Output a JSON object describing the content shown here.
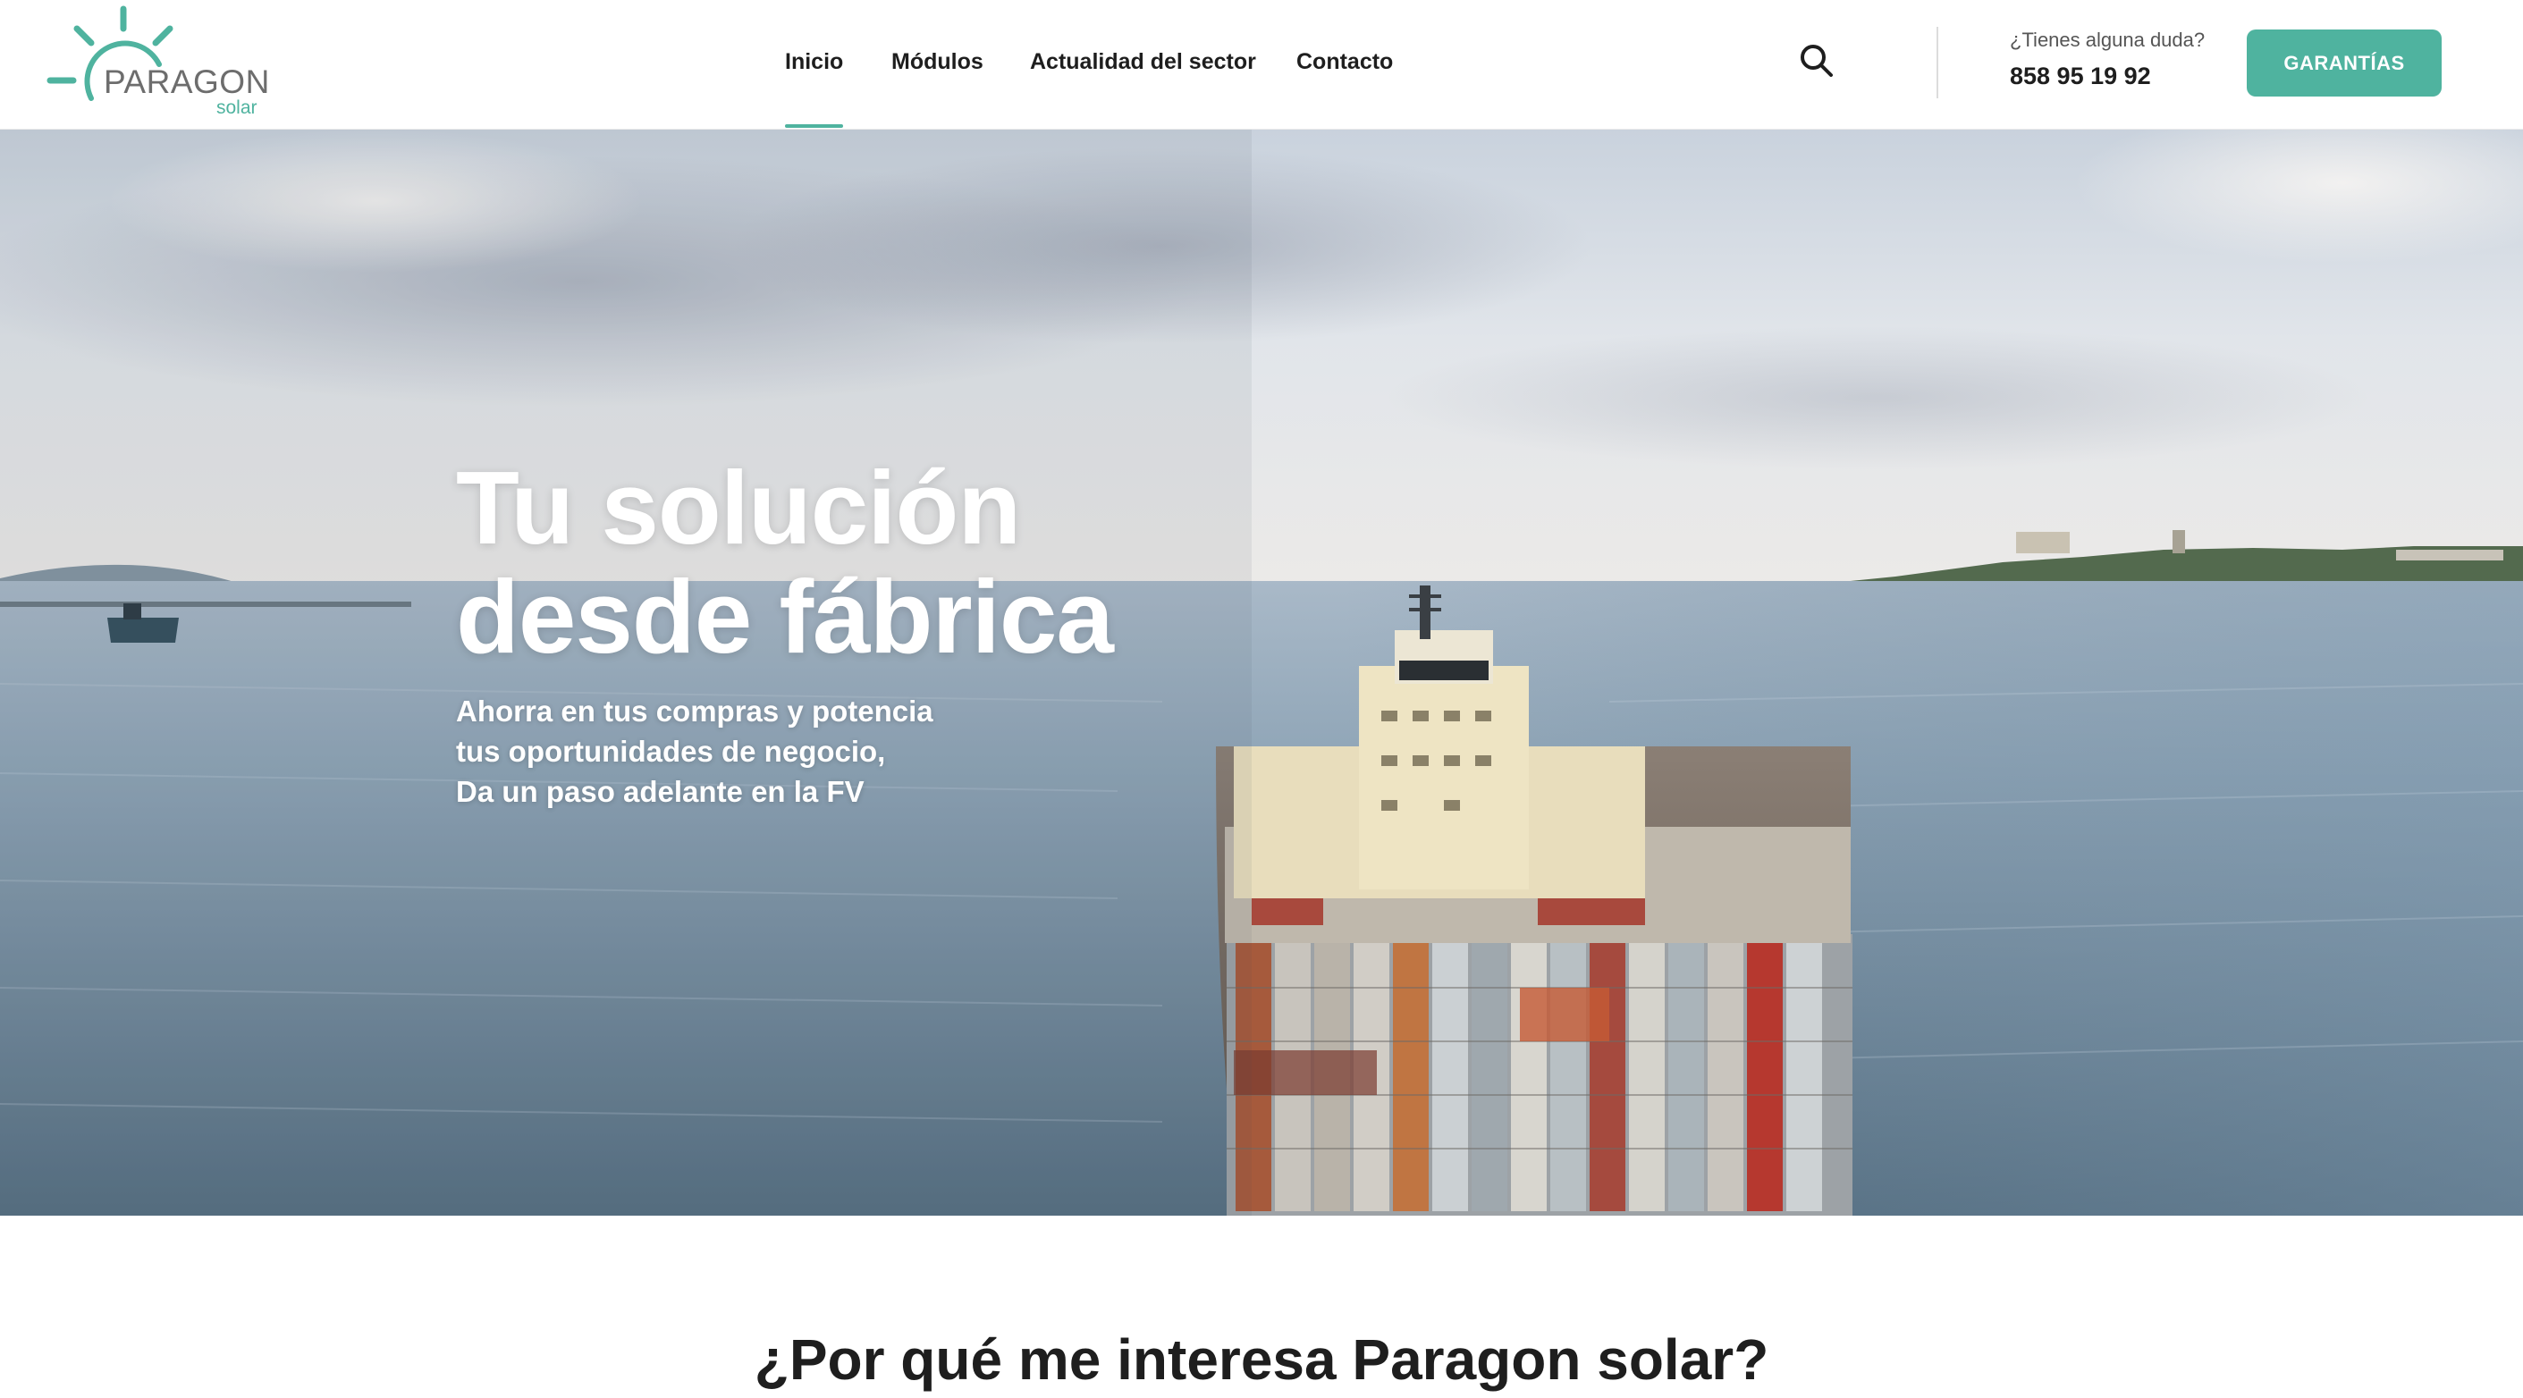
{
  "header": {
    "logo": {
      "brand": "PARAGON",
      "tagline": "solar"
    },
    "nav": [
      {
        "label": "Inicio",
        "active": true
      },
      {
        "label": "Módulos",
        "active": false
      },
      {
        "label": "Actualidad del sector",
        "active": false
      },
      {
        "label": "Contacto",
        "active": false
      }
    ],
    "search_icon": "search-icon",
    "help": {
      "question": "¿Tienes alguna duda?",
      "phone": "858 95 19 92"
    },
    "cta_label": "GARANTÍAS"
  },
  "hero": {
    "title_line1": "Tu solución",
    "title_line2": "desde fábrica",
    "sub_line1": "Ahorra en tus compras y potencia",
    "sub_line2": "tus oportunidades de negocio,",
    "sub_line3": "Da un paso adelante en la FV"
  },
  "section": {
    "title": "¿Por qué me interesa Paragon solar?"
  },
  "colors": {
    "accent": "#4fb39f",
    "text": "#1e1e1e",
    "sea": "#6f8ea3",
    "sky": "#dfe5ec"
  }
}
